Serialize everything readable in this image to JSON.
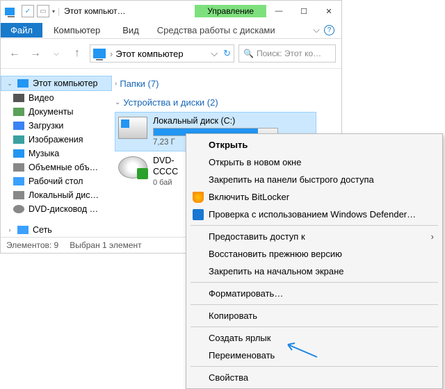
{
  "window": {
    "title": "Этот компьют…",
    "mgmt_tab": "Управление"
  },
  "ribbon": {
    "file": "Файл",
    "computer": "Компьютер",
    "view": "Вид",
    "disktools": "Средства работы с дисками"
  },
  "address": {
    "location": "Этот компьютер"
  },
  "search": {
    "placeholder": "Поиск: Этот ко…"
  },
  "sidebar": {
    "thispc": "Этот компьютер",
    "items": [
      "Видео",
      "Документы",
      "Загрузки",
      "Изображения",
      "Музыка",
      "Объемные объ…",
      "Рабочий стол",
      "Локальный дис…",
      "DVD-дисковод …"
    ],
    "network": "Сеть"
  },
  "groups": {
    "folders": "Папки (7)",
    "devices": "Устройства и диски (2)"
  },
  "drives": {
    "c": {
      "title": "Локальный диск (C:)",
      "sub": "7,23 Г",
      "fill_pct": 84
    },
    "dvd": {
      "title": "DVD-",
      "title2": "CCCC",
      "sub": "0 бай"
    }
  },
  "status": {
    "items": "Элементов: 9",
    "selected": "Выбран 1 элемент"
  },
  "ctx": {
    "open": "Открыть",
    "open_new": "Открыть в новом окне",
    "pin_qa": "Закрепить на панели быстрого доступа",
    "bitlocker": "Включить BitLocker",
    "defender": "Проверка с использованием Windows Defender…",
    "share": "Предоставить доступ к",
    "restore": "Восстановить прежнюю версию",
    "pin_start": "Закрепить на начальном экране",
    "format": "Форматировать…",
    "copy": "Копировать",
    "shortcut": "Создать ярлык",
    "rename": "Переименовать",
    "props": "Свойства"
  }
}
